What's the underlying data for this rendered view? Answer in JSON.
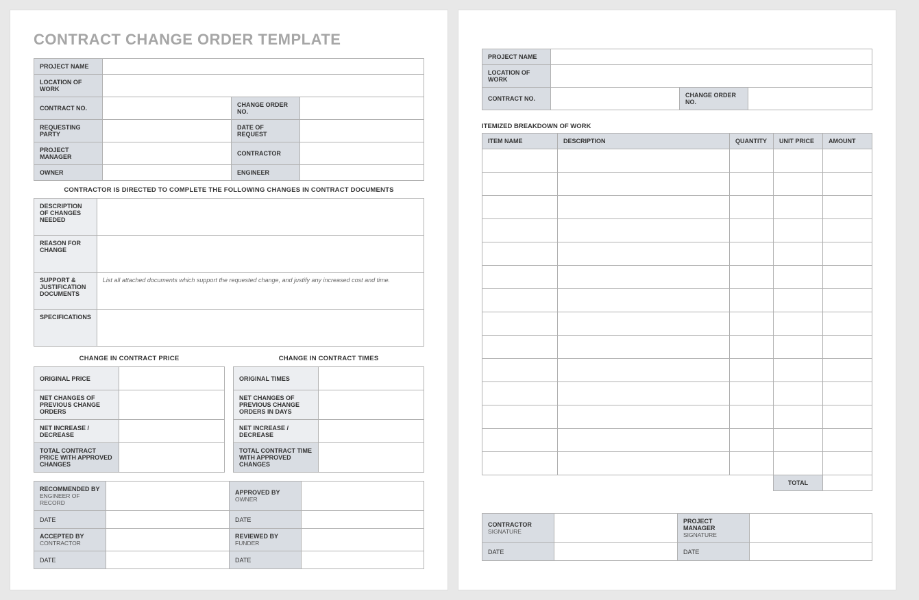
{
  "title": "CONTRACT CHANGE ORDER TEMPLATE",
  "header": {
    "project_name": "PROJECT NAME",
    "location_of_work": "LOCATION OF WORK",
    "contract_no": "CONTRACT NO.",
    "change_order_no": "CHANGE ORDER NO.",
    "requesting_party": "REQUESTING PARTY",
    "date_of_request": "DATE OF REQUEST",
    "project_manager": "PROJECT MANAGER",
    "contractor": "CONTRACTOR",
    "owner": "OWNER",
    "engineer": "ENGINEER"
  },
  "changes_caption": "CONTRACTOR IS DIRECTED TO COMPLETE THE FOLLOWING CHANGES IN CONTRACT DOCUMENTS",
  "changes": {
    "description": "DESCRIPTION OF CHANGES NEEDED",
    "reason": "REASON FOR CHANGE",
    "support": "SUPPORT & JUSTIFICATION DOCUMENTS",
    "support_placeholder": "List all attached documents which support the requested change, and justify any increased cost and time.",
    "specifications": "SPECIFICATIONS"
  },
  "price_caption": "CHANGE IN CONTRACT PRICE",
  "times_caption": "CHANGE IN CONTRACT TIMES",
  "price": {
    "original": "ORIGINAL PRICE",
    "net_prev": "NET CHANGES OF PREVIOUS CHANGE ORDERS",
    "net_incdec": "NET INCREASE / DECREASE",
    "total": "TOTAL CONTRACT PRICE WITH APPROVED CHANGES"
  },
  "times": {
    "original": "ORIGINAL TIMES",
    "net_prev": "NET CHANGES OF PREVIOUS CHANGE ORDERS IN DAYS",
    "net_incdec": "NET INCREASE / DECREASE",
    "total": "TOTAL CONTRACT TIME WITH APPROVED CHANGES"
  },
  "approvals": {
    "recommended_by": "RECOMMENDED BY",
    "recommended_sub": "ENGINEER OF RECORD",
    "approved_by": "APPROVED BY",
    "approved_sub": "OWNER",
    "accepted_by": "ACCEPTED BY",
    "accepted_sub": "CONTRACTOR",
    "reviewed_by": "REVIEWED BY",
    "reviewed_sub": "FUNDER",
    "date": "DATE"
  },
  "right_header": {
    "project_name": "PROJECT NAME",
    "location_of_work": "LOCATION OF WORK",
    "contract_no": "CONTRACT NO.",
    "change_order_no": "CHANGE ORDER NO."
  },
  "itemized_caption": "ITEMIZED BREAKDOWN OF WORK",
  "itemized_cols": {
    "item_name": "ITEM NAME",
    "description": "DESCRIPTION",
    "quantity": "QUANTITY",
    "unit_price": "UNIT PRICE",
    "amount": "AMOUNT"
  },
  "itemized_row_count": 14,
  "total_label": "TOTAL",
  "sig_right": {
    "contractor": "CONTRACTOR",
    "pm": "PROJECT MANAGER",
    "signature": "SIGNATURE",
    "date": "DATE"
  }
}
